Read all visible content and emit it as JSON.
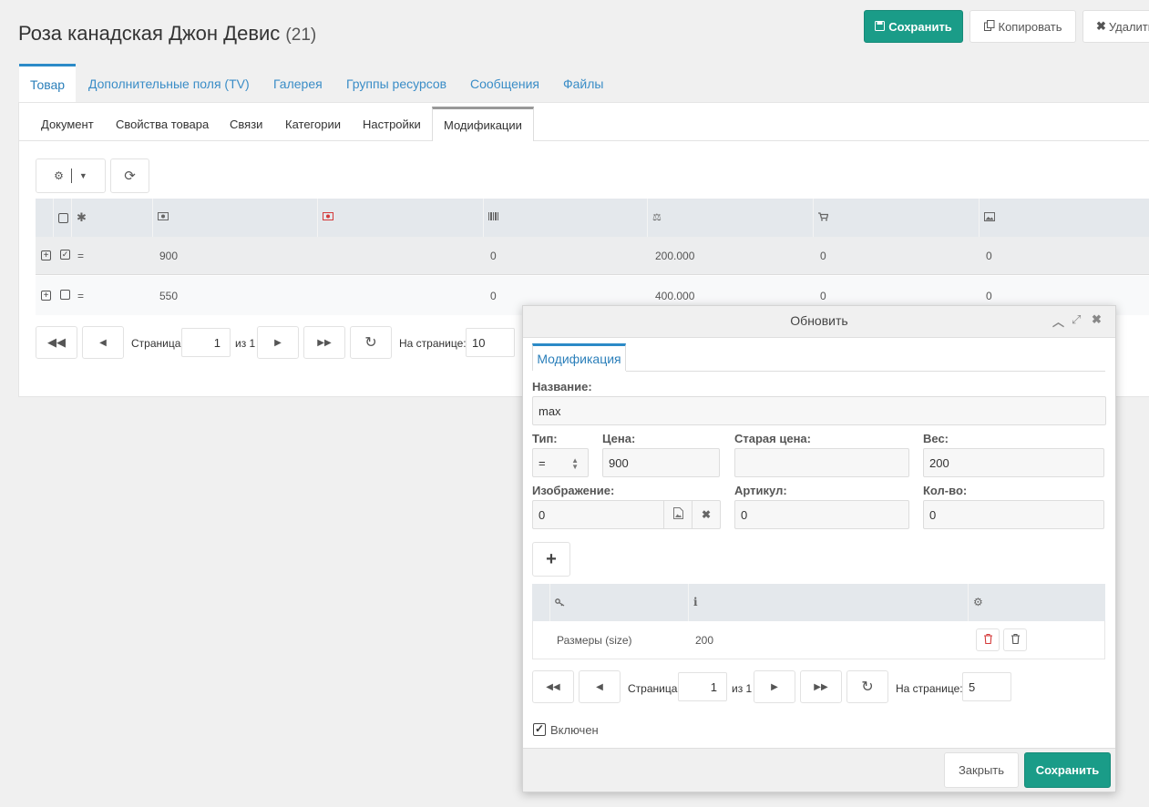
{
  "page": {
    "title": "Роза канадская Джон Девис",
    "count": "(21)"
  },
  "top_actions": {
    "save": "Сохранить",
    "copy": "Копировать",
    "delete": "Удалить"
  },
  "main_tabs": [
    "Товар",
    "Дополнительные поля (TV)",
    "Галерея",
    "Группы ресурсов",
    "Сообщения",
    "Файлы"
  ],
  "sub_tabs": [
    "Документ",
    "Свойства товара",
    "Связи",
    "Категории",
    "Настройки",
    "Модификации"
  ],
  "grid": {
    "header_icons": [
      "asterisk-icon",
      "money-icon",
      "old-price-icon",
      "barcode-icon",
      "weight-icon",
      "cart-icon",
      "image-icon"
    ],
    "rows": [
      {
        "checked": "✓",
        "type": "=",
        "price": "900",
        "old_price": "",
        "article": "0",
        "weight": "200.000",
        "count": "0",
        "image": "0"
      },
      {
        "checked": "",
        "type": "=",
        "price": "550",
        "old_price": "",
        "article": "0",
        "weight": "400.000",
        "count": "0",
        "image": "0"
      }
    ],
    "pager": {
      "page_label": "Страница",
      "page": "1",
      "of_label": "из 1",
      "per_page_label": "На странице:",
      "per_page": "10"
    }
  },
  "modal": {
    "title": "Обновить",
    "tab": "Модификация",
    "name_label": "Название:",
    "name_value": "max",
    "type_label": "Тип:",
    "type_value": "=",
    "price_label": "Цена:",
    "price_value": "900",
    "old_price_label": "Старая цена:",
    "old_price_value": "",
    "weight_label": "Вес:",
    "weight_value": "200",
    "image_label": "Изображение:",
    "image_value": "0",
    "article_label": "Артикул:",
    "article_value": "0",
    "count_label": "Кол-во:",
    "count_value": "0",
    "add_symbol": "+",
    "options": {
      "rows": [
        {
          "key": "Размеры (size)",
          "value": "200"
        }
      ]
    },
    "pager": {
      "page_label": "Страница",
      "page": "1",
      "of_label": "из 1",
      "per_page_label": "На странице:",
      "per_page": "5"
    },
    "enabled_label": "Включен",
    "close": "Закрыть",
    "save": "Сохранить"
  },
  "colors": {
    "primary": "#1a9c88",
    "link": "#3a8dc7"
  }
}
